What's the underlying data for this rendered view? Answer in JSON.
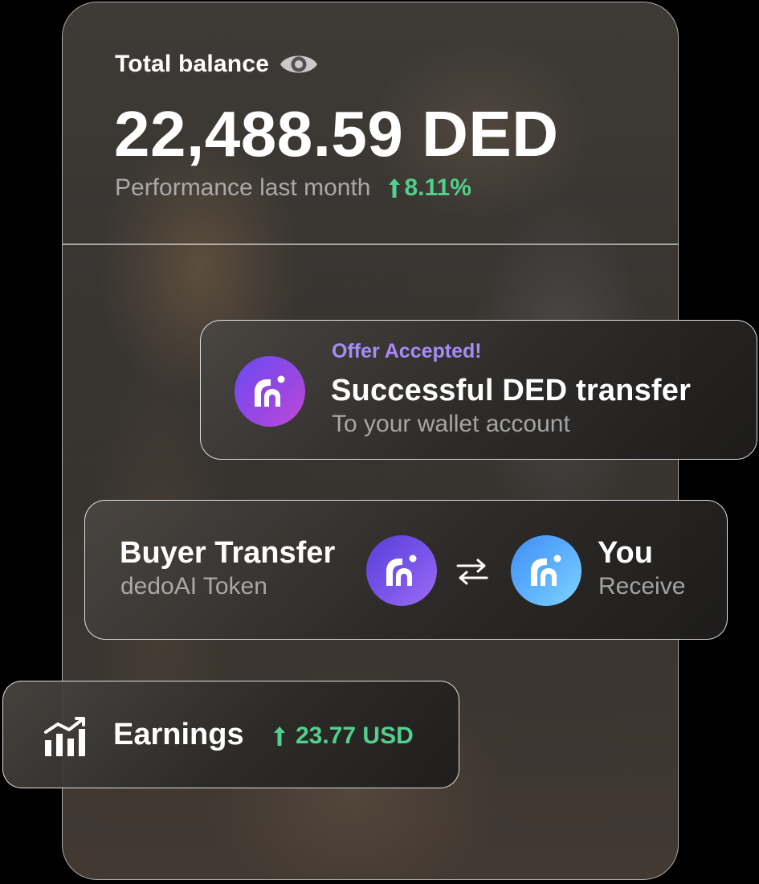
{
  "balance": {
    "label": "Total balance",
    "amount": "22,488.59 DED",
    "performance_label": "Performance last month",
    "performance_value": "8.11%",
    "visibility_icon": "eye-icon"
  },
  "offer": {
    "status": "Offer Accepted!",
    "title": "Successful DED transfer",
    "subtitle": "To your wallet account",
    "icon": "dedo-logo-icon"
  },
  "transfer": {
    "from_title": "Buyer Transfer",
    "from_subtitle": "dedoAI Token",
    "to_title": "You",
    "to_subtitle": "Receive",
    "swap_icon": "swap-arrows-icon"
  },
  "earnings": {
    "label": "Earnings",
    "value": "23.77 USD",
    "icon": "bar-chart-trend-icon"
  },
  "colors": {
    "positive": "#52d08d",
    "accent_purple": "#a98bf7",
    "logo_blue": "#5fb3ff",
    "logo_violet": "#7a55ec"
  }
}
